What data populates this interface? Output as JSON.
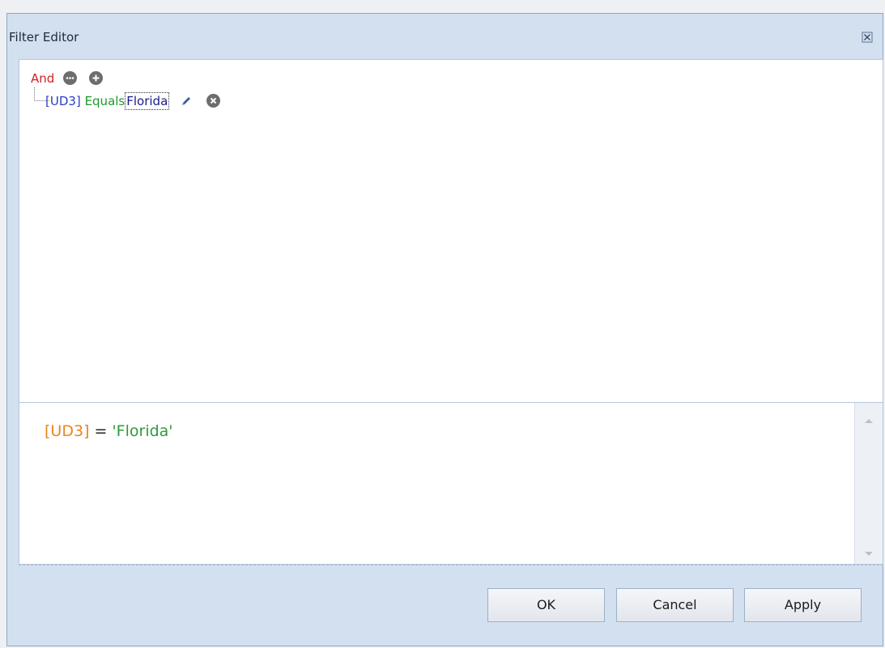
{
  "dialog": {
    "title": "Filter Editor",
    "close_icon": "close-icon"
  },
  "tree": {
    "group_operator": "And",
    "group_menu_icon": "more-options-icon",
    "add_condition_icon": "add-icon",
    "condition": {
      "field": "[UD3]",
      "operator": "Equals",
      "value": "Florida",
      "edit_icon": "pencil-icon",
      "remove_icon": "remove-icon"
    }
  },
  "expression": {
    "field": "[UD3]",
    "equals": " = ",
    "value": "'Florida'"
  },
  "buttons": {
    "ok": "OK",
    "cancel": "Cancel",
    "apply": "Apply"
  },
  "colors": {
    "group_operator": "#d42020",
    "field": "#2a3ec4",
    "operator": "#1d9a2a",
    "expr_field": "#e8861c",
    "expr_value": "#2e9a3a"
  }
}
